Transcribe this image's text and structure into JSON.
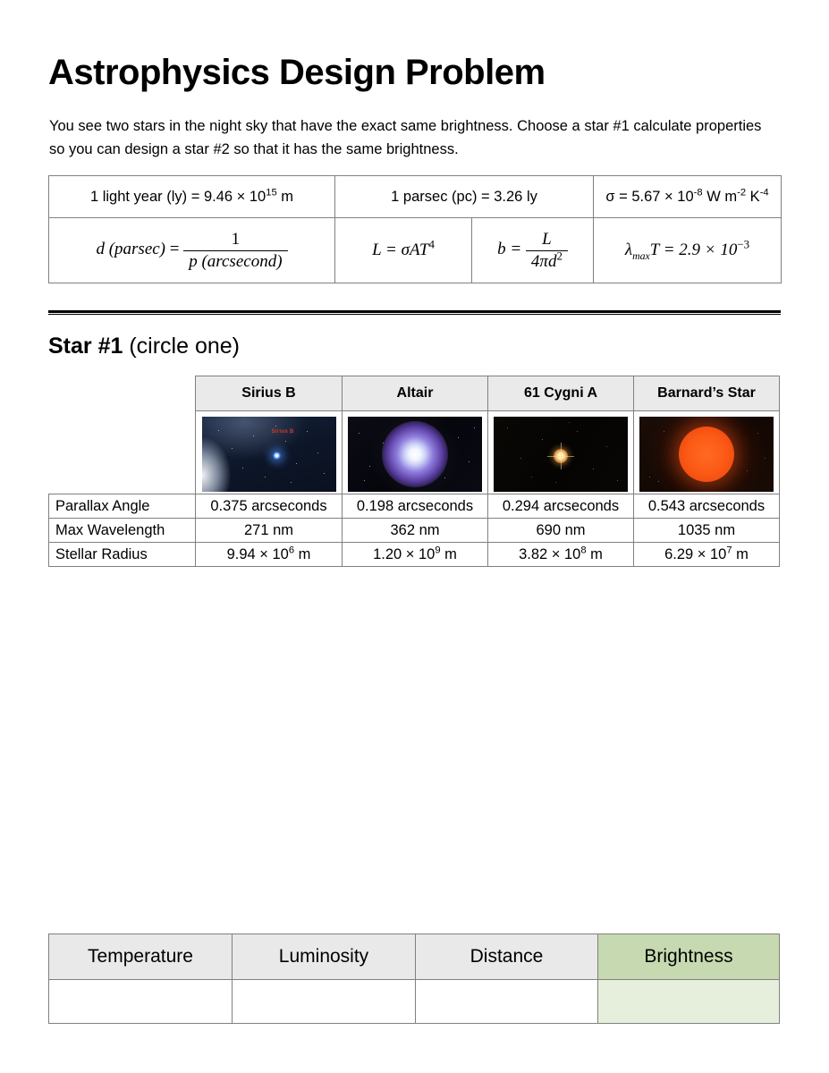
{
  "document": {
    "title": "Astrophysics Design Problem",
    "intro": "You see two stars in the night sky that have the exact same brightness. Choose a star #1 calculate properties so you can design a star #2 so that it has the same brightness."
  },
  "constants_table": {
    "row1": [
      {
        "name": "light-year-constant",
        "prefix": "1 light year (ly) = 9.46 × 10",
        "sup": "15",
        "suffix": " m"
      },
      {
        "name": "parsec-constant",
        "prefix": "1 parsec (pc) = 3.26 ly",
        "sup": "",
        "suffix": ""
      },
      {
        "name": "stefan-boltzmann-constant",
        "prefix": "σ = 5.67 × 10",
        "sup": "-8",
        "suffix": " W m",
        "sup2": "-2",
        "suffix2": " K",
        "sup3": "-4"
      }
    ],
    "row2": [
      {
        "name": "distance-parsec-formula",
        "latex": "d (parsec) = 1 / p (arcsecond)"
      },
      {
        "name": "luminosity-formula",
        "latex": "L = σAT^4"
      },
      {
        "name": "brightness-formula",
        "latex": "b = L / 4πd^2"
      },
      {
        "name": "wien-law-formula",
        "latex": "λ_max T = 2.9 × 10^-3"
      }
    ],
    "labels": {
      "d_paren": "d (parsec)",
      "equals": "=",
      "one": "1",
      "p_paren": "p (arcsecond)",
      "L_eq": "L = ",
      "sigmaAT": "σAT",
      "four": "4",
      "b_eq": "b = ",
      "L_num": "L",
      "den_4pid": "4πd",
      "two": "2",
      "lambda": "λ",
      "max": "max",
      "T_eq": "T = 2.9 × 10",
      "neg3": "−3"
    }
  },
  "star_section": {
    "heading_bold": "Star #1",
    "heading_rest": " (circle one)",
    "columns": [
      {
        "name": "Sirius B",
        "image": {
          "icon": "sirius-b-star-photo",
          "caption": "Sirius B"
        },
        "parallax_angle": "0.375 arcseconds",
        "max_wavelength": "271 nm",
        "stellar_radius_mantissa": "9.94 × 10",
        "stellar_radius_exponent": "6",
        "stellar_radius_unit": " m"
      },
      {
        "name": "Altair",
        "image": {
          "icon": "altair-star-photo",
          "caption": ""
        },
        "parallax_angle": "0.198 arcseconds",
        "max_wavelength": "362 nm",
        "stellar_radius_mantissa": "1.20 × 10",
        "stellar_radius_exponent": "9",
        "stellar_radius_unit": " m"
      },
      {
        "name": "61 Cygni A",
        "image": {
          "icon": "61-cygni-a-star-photo",
          "caption": ""
        },
        "parallax_angle": "0.294 arcseconds",
        "max_wavelength": "690 nm",
        "stellar_radius_mantissa": "3.82 × 10",
        "stellar_radius_exponent": "8",
        "stellar_radius_unit": " m"
      },
      {
        "name": "Barnard’s Star",
        "image": {
          "icon": "barnards-star-photo",
          "caption": ""
        },
        "parallax_angle": "0.543 arcseconds",
        "max_wavelength": "1035 nm",
        "stellar_radius_mantissa": "6.29 × 10",
        "stellar_radius_exponent": "7",
        "stellar_radius_unit": " m"
      }
    ],
    "row_labels": {
      "parallax": "Parallax Angle",
      "wavelength": "Max Wavelength",
      "radius": "Stellar Radius"
    }
  },
  "answer_table": {
    "headers": [
      "Temperature",
      "Luminosity",
      "Distance",
      "Brightness"
    ],
    "values": [
      "",
      "",
      "",
      ""
    ],
    "highlight_color": "#c6d9b0",
    "highlight_body_color": "#e6efdc"
  }
}
